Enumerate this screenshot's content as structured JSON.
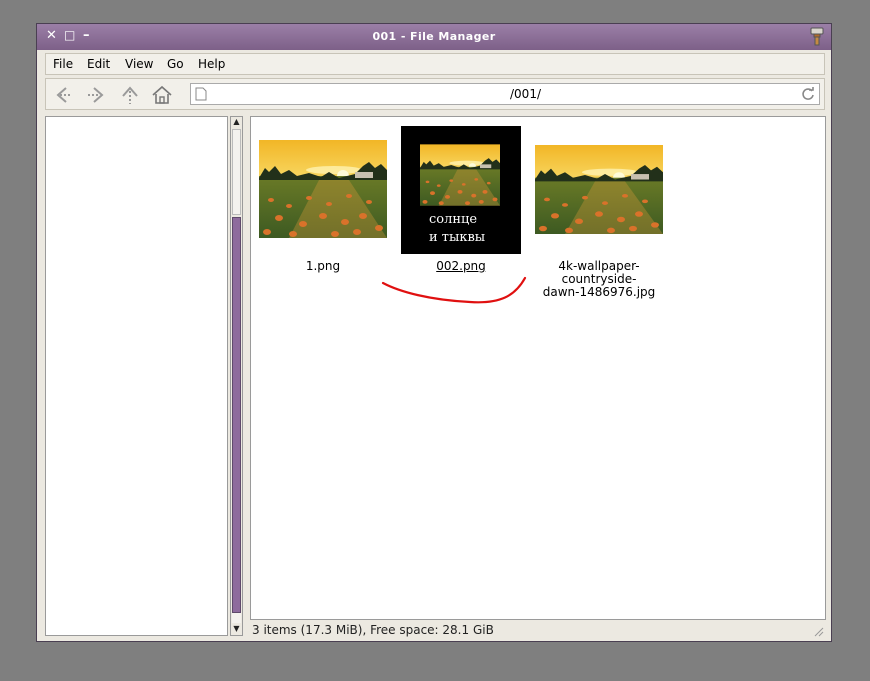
{
  "window": {
    "title": "001 - File Manager",
    "close_glyph": "✕",
    "maximize_glyph": "□",
    "minimize_glyph": "–"
  },
  "menu": {
    "items": [
      {
        "label": "File"
      },
      {
        "label": "Edit"
      },
      {
        "label": "View"
      },
      {
        "label": "Go"
      },
      {
        "label": "Help"
      }
    ]
  },
  "toolbar": {
    "location": "/001/"
  },
  "files": [
    {
      "name": "1.png",
      "icon": "image-thumbnail"
    },
    {
      "name": "002.png",
      "icon": "image-thumbnail",
      "selected": true,
      "caption_line1": "солнце",
      "caption_line2": "и тыквы"
    },
    {
      "name_line1": "4k-wallpaper-",
      "name_line2": "countryside-",
      "name_line3": "dawn-1486976.jpg",
      "icon": "image-thumbnail"
    }
  ],
  "status": {
    "text": "3 items (17.3 MiB), Free space: 28.1 GiB"
  },
  "colors": {
    "titlebar": "#8a6d96",
    "scroll_thumb": "#8e6b9d",
    "annotation": "#e01010"
  }
}
